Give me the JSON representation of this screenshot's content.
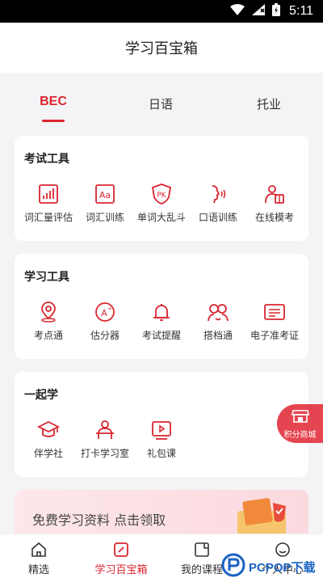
{
  "status_bar": {
    "time": "5:11"
  },
  "header": {
    "title": "学习百宝箱"
  },
  "tabs": [
    {
      "label": "BEC",
      "active": true
    },
    {
      "label": "日语",
      "active": false
    },
    {
      "label": "托业",
      "active": false
    }
  ],
  "exam_tools": {
    "title": "考试工具",
    "items": [
      {
        "label": "词汇量评估",
        "icon": "bar-chart-icon"
      },
      {
        "label": "词汇训练",
        "icon": "aa-letters-icon"
      },
      {
        "label": "单词大乱斗",
        "icon": "shield-pk-icon"
      },
      {
        "label": "口语训练",
        "icon": "speaking-icon"
      },
      {
        "label": "在线模考",
        "icon": "person-book-icon"
      }
    ]
  },
  "study_tools": {
    "title": "学习工具",
    "items": [
      {
        "label": "考点通",
        "icon": "location-pin-icon"
      },
      {
        "label": "估分器",
        "icon": "grade-a-plus-icon"
      },
      {
        "label": "考试提醒",
        "icon": "bell-icon"
      },
      {
        "label": "搭档通",
        "icon": "partners-icon"
      },
      {
        "label": "电子准考证",
        "icon": "id-card-icon"
      }
    ]
  },
  "study_together": {
    "title": "一起学",
    "items": [
      {
        "label": "伴学社",
        "icon": "graduation-cap-icon"
      },
      {
        "label": "打卡学习室",
        "icon": "desk-person-icon"
      },
      {
        "label": "礼包课",
        "icon": "video-play-icon"
      }
    ]
  },
  "promo": {
    "text": "免费学习资料  点击领取"
  },
  "floating": {
    "label": "积分商城"
  },
  "bottom_nav": [
    {
      "label": "精选",
      "icon": "home-icon",
      "active": false
    },
    {
      "label": "学习百宝箱",
      "icon": "toolbox-icon",
      "active": true
    },
    {
      "label": "我的课程",
      "icon": "course-icon",
      "active": false
    },
    {
      "label": "个人中心",
      "icon": "user-icon",
      "active": false
    }
  ],
  "watermark": {
    "text": "PCPOP下载"
  },
  "colors": {
    "accent": "#d9252f",
    "background": "#f4f4f6"
  }
}
